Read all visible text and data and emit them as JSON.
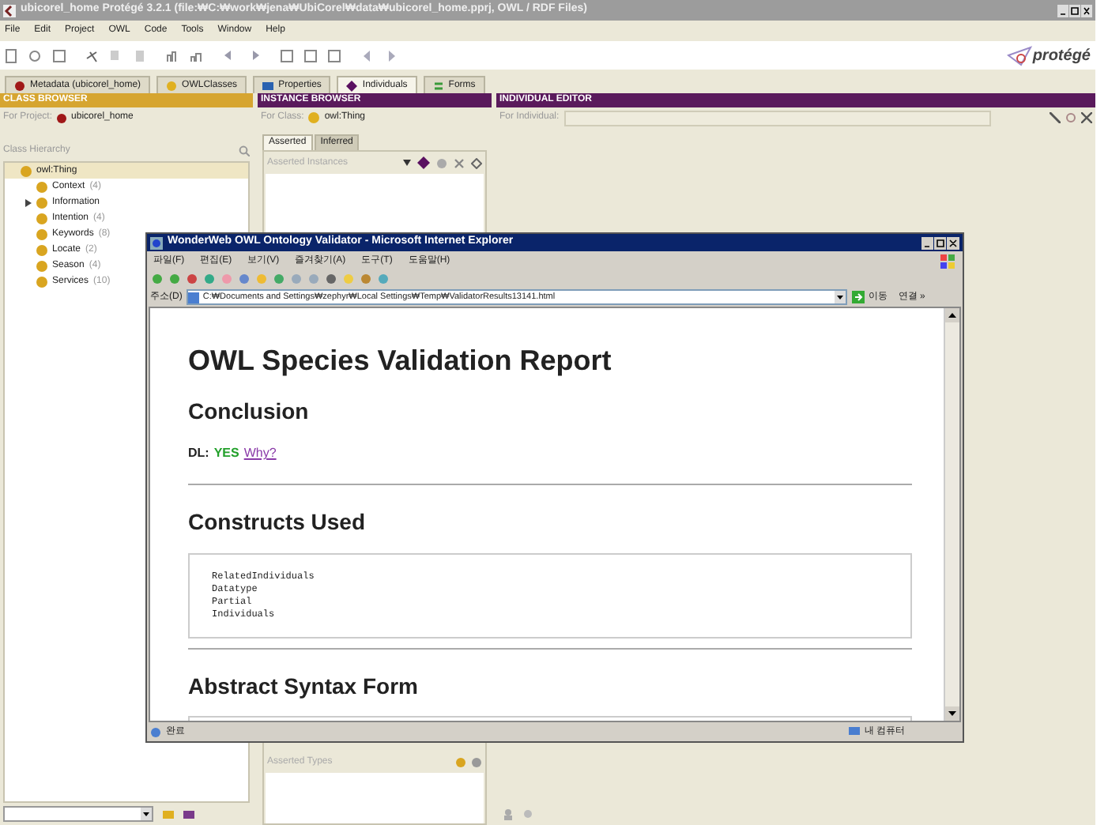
{
  "window": {
    "title": "ubicorel_home  Protégé 3.2.1     (file:₩C:₩work₩jena₩UbiCorel₩data₩ubicorel_home.pprj, OWL / RDF Files)",
    "logo": "protégé"
  },
  "menu": [
    "File",
    "Edit",
    "Project",
    "OWL",
    "Code",
    "Tools",
    "Window",
    "Help"
  ],
  "tabs": [
    {
      "label": "Metadata (ubicorel_home)",
      "selected": false,
      "kind": "metadata"
    },
    {
      "label": "OWLClasses",
      "selected": false,
      "kind": "classes"
    },
    {
      "label": "Properties",
      "selected": false,
      "kind": "properties"
    },
    {
      "label": "Individuals",
      "selected": true,
      "kind": "individuals"
    },
    {
      "label": "Forms",
      "selected": false,
      "kind": "forms"
    }
  ],
  "class_browser": {
    "header": "CLASS BROWSER",
    "project_label": "For Project:",
    "project": "ubicorel_home",
    "hierarchy_label": "Class Hierarchy",
    "tree": [
      {
        "label": "owl:Thing",
        "selected": true,
        "expandable": false,
        "children": [
          {
            "label": "Context",
            "count": "(4)",
            "selected": false,
            "expandable": false
          },
          {
            "label": "Information",
            "selected": false,
            "expandable": true
          },
          {
            "label": "Intention",
            "count": "(4)",
            "selected": false,
            "expandable": false
          },
          {
            "label": "Keywords",
            "count": "(8)",
            "selected": false,
            "expandable": false
          },
          {
            "label": "Locate",
            "count": "(2)",
            "selected": false,
            "expandable": false
          },
          {
            "label": "Season",
            "count": "(4)",
            "selected": false,
            "expandable": false
          },
          {
            "label": "Services",
            "count": "(10)",
            "selected": false,
            "expandable": false
          }
        ]
      }
    ]
  },
  "instance_browser": {
    "header": "INSTANCE BROWSER",
    "class_label": "For Class:",
    "class": "owl:Thing",
    "tabs": [
      {
        "label": "Asserted",
        "selected": true
      },
      {
        "label": "Inferred",
        "selected": false
      }
    ],
    "instances_label": "Asserted Instances",
    "types_label": "Asserted Types"
  },
  "individual_editor": {
    "header": "INDIVIDUAL EDITOR",
    "label": "For Individual:"
  },
  "browser": {
    "title": "WonderWeb OWL Ontology Validator - Microsoft Internet Explorer",
    "menu": [
      "파일(F)",
      "편집(E)",
      "보기(V)",
      "즐겨찾기(A)",
      "도구(T)",
      "도움말(H)"
    ],
    "address_label": "주소(D)",
    "address": "C:₩Documents and Settings₩zephyr₩Local Settings₩Temp₩ValidatorResults13141.html",
    "go": "이동",
    "links": "연결 »",
    "report": {
      "title": "OWL Species Validation Report",
      "conclusion_heading": "Conclusion",
      "dl_label": "DL:",
      "dl_value": "YES",
      "why_link": "Why?",
      "constructs_heading": "Constructs Used",
      "constructs": [
        "RelatedIndividuals",
        "Datatype",
        "Partial",
        "Individuals"
      ],
      "abstract_heading": "Abstract Syntax Form"
    },
    "status": "완료",
    "zone": "내 컴퓨터"
  }
}
